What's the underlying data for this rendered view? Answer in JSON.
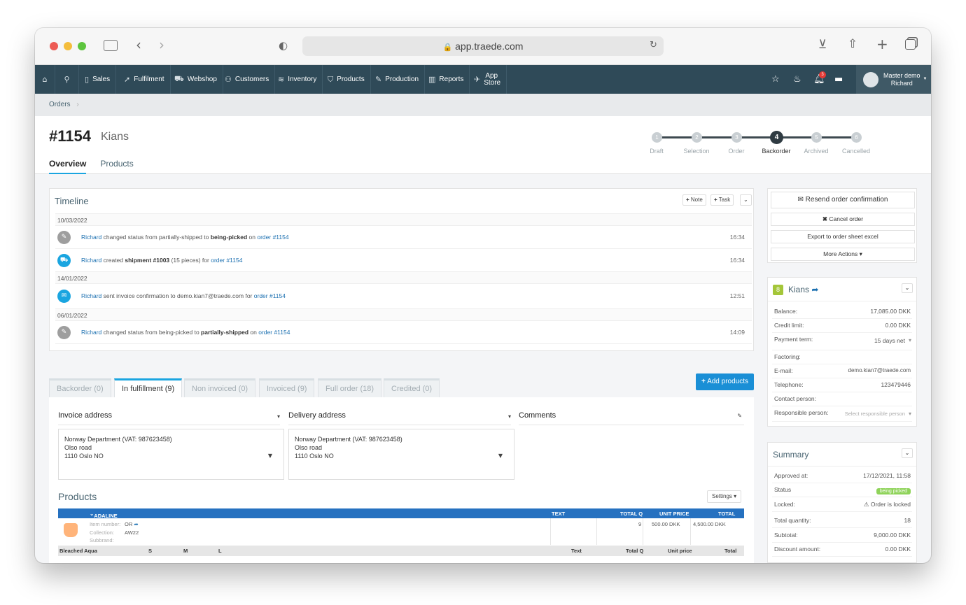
{
  "browser": {
    "url": "app.traede.com"
  },
  "nav": {
    "items": [
      {
        "label": "Sales",
        "icon": "file-icon"
      },
      {
        "label": "Fulfilment",
        "icon": "send-icon"
      },
      {
        "label": "Webshop",
        "icon": "cart-icon"
      },
      {
        "label": "Customers",
        "icon": "users-icon"
      },
      {
        "label": "Inventory",
        "icon": "layers-icon"
      },
      {
        "label": "Products",
        "icon": "shirt-icon"
      },
      {
        "label": "Production",
        "icon": "pencil-icon"
      },
      {
        "label": "Reports",
        "icon": "report-icon"
      },
      {
        "label": "App Store",
        "icon": "rocket-icon"
      }
    ],
    "notification_count": "3",
    "user_line1": "Master demo",
    "user_line2": "Richard"
  },
  "breadcrumb": {
    "orders": "Orders"
  },
  "order": {
    "number": "#1154",
    "customer": "Kians",
    "tabs": [
      "Overview",
      "Products"
    ]
  },
  "steps": [
    {
      "num": "1",
      "label": "Draft"
    },
    {
      "num": "2",
      "label": "Selection"
    },
    {
      "num": "3",
      "label": "Order"
    },
    {
      "num": "4",
      "label": "Backorder"
    },
    {
      "num": "5",
      "label": "Archived"
    },
    {
      "num": "6",
      "label": "Cancelled"
    }
  ],
  "timeline": {
    "title": "Timeline",
    "note_btn": "Note",
    "task_btn": "Task",
    "dates": [
      "10/03/2022",
      "14/01/2022",
      "06/01/2022"
    ],
    "entries": [
      {
        "user": "Richard",
        "pre": " changed status from partially-shipped to ",
        "bold": "being-picked",
        "mid": " on ",
        "link": "order #1154",
        "time": "16:34"
      },
      {
        "user": "Richard",
        "pre": " created ",
        "bold": "shipment #1003",
        "mid": " (15 pieces) for ",
        "link": "order #1154",
        "time": "16:34"
      },
      {
        "user": "Richard",
        "pre": " sent invoice confirmation to demo.kian7@traede.com for ",
        "bold": "",
        "mid": "",
        "link": "order #1154",
        "time": "12:51"
      },
      {
        "user": "Richard",
        "pre": " changed status from being-picked to ",
        "bold": "partially-shipped",
        "mid": " on ",
        "link": "order #1154",
        "time": "14:09"
      }
    ]
  },
  "fulfilment_tabs": [
    "Backorder (0)",
    "In fulfillment (9)",
    "Non invoiced (0)",
    "Invoiced (9)",
    "Full order (18)",
    "Credited (0)"
  ],
  "add_products": "Add products",
  "addresses": {
    "invoice_title": "Invoice address",
    "delivery_title": "Delivery address",
    "comments_title": "Comments",
    "invoice": [
      "Norway Department (VAT: 987623458)",
      "Olso road",
      "1110 Oslo NO"
    ],
    "delivery": [
      "Norway Department (VAT: 987623458)",
      "Olso road",
      "1110 Oslo NO"
    ]
  },
  "products": {
    "title": "Products",
    "settings": "Settings",
    "header": {
      "name": "ADALINE",
      "text": "TEXT",
      "total_q": "TOTAL Q",
      "unit_price": "UNIT PRICE",
      "total": "TOTAL"
    },
    "item_number_label": "Item number:",
    "item_number": "OR",
    "collection_label": "Collection:",
    "collection": "AW22",
    "subbrand_label": "Subbrand:",
    "total_q": "9",
    "unit_price": "500.00 DKK",
    "total": "4,500.00 DKK",
    "variant": "Bleached Aqua",
    "sizes": [
      "S",
      "M",
      "L"
    ],
    "size_cols": {
      "text": "Text",
      "total_q": "Total Q",
      "unit_price": "Unit price",
      "total": "Total"
    }
  },
  "actions": {
    "resend": "Resend order confirmation",
    "cancel": "Cancel order",
    "export": "Export to order sheet excel",
    "more": "More Actions"
  },
  "customer": {
    "badge": "8",
    "name": "Kians",
    "fields": [
      {
        "k": "Balance:",
        "v": "17,085.00 DKK"
      },
      {
        "k": "Credit limit:",
        "v": "0.00 DKK"
      },
      {
        "k": "Payment term:",
        "v": "15 days net"
      },
      {
        "k": "Factoring:",
        "v": ""
      },
      {
        "k": "E-mail:",
        "v": "demo.kian7@traede.com"
      },
      {
        "k": "Telephone:",
        "v": "123479446"
      },
      {
        "k": "Contact person:",
        "v": ""
      },
      {
        "k": "Responsible person:",
        "v": "Select responsible person"
      }
    ]
  },
  "summary": {
    "title": "Summary",
    "fields": [
      {
        "k": "Approved at:",
        "v": "17/12/2021, 11:58"
      },
      {
        "k": "Status",
        "v": "being picked"
      },
      {
        "k": "Locked:",
        "v": "Order is locked"
      },
      {
        "k": "Total quantity:",
        "v": "18"
      },
      {
        "k": "Subtotal:",
        "v": "9,000.00 DKK"
      },
      {
        "k": "Discount amount:",
        "v": "0.00 DKK"
      }
    ]
  }
}
